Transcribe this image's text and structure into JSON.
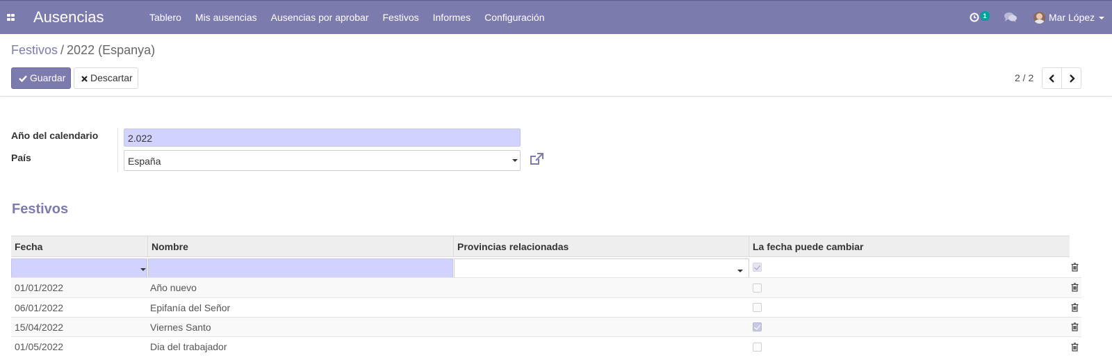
{
  "navbar": {
    "app_title": "Ausencias",
    "menu": [
      "Tablero",
      "Mis ausencias",
      "Ausencias por aprobar",
      "Festivos",
      "Informes",
      "Configuración"
    ],
    "activity_count": "1",
    "user_name": "Mar López",
    "bar_color": "#7c7bad"
  },
  "breadcrumb": {
    "parent": "Festivos",
    "separator": "/",
    "current": "2022 (Espanya)"
  },
  "actions": {
    "save_label": "Guardar",
    "discard_label": "Descartar"
  },
  "pager": {
    "value": "2 / 2"
  },
  "form": {
    "year_label": "Año del calendario",
    "year_value": "2.022",
    "country_label": "País",
    "country_value": "España"
  },
  "section": {
    "title": "Festivos"
  },
  "table": {
    "columns": [
      "Fecha",
      "Nombre",
      "Provincias relacionadas",
      "La fecha puede cambiar"
    ],
    "edit_row": {
      "fecha": "",
      "nombre": "",
      "provincias": "",
      "puede_cambiar": true
    },
    "rows": [
      {
        "fecha": "01/01/2022",
        "nombre": "Año nuevo",
        "provincias": "",
        "puede_cambiar": false
      },
      {
        "fecha": "06/01/2022",
        "nombre": "Epifanía del Señor",
        "provincias": "",
        "puede_cambiar": false
      },
      {
        "fecha": "15/04/2022",
        "nombre": "Viernes Santo",
        "provincias": "",
        "puede_cambiar": true
      },
      {
        "fecha": "01/05/2022",
        "nombre": "Dia del trabajador",
        "provincias": "",
        "puede_cambiar": false
      }
    ]
  }
}
